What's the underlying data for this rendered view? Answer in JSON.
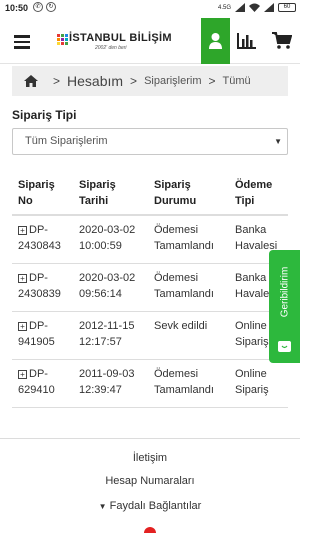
{
  "status_bar": {
    "time": "10:50",
    "battery": "60",
    "network": "4.5G"
  },
  "header": {
    "logo_text": "İSTANBUL BİLİŞİM",
    "logo_tagline": "2002' den beri",
    "icons": [
      "menu-icon",
      "user-icon",
      "bar-chart-icon",
      "cart-icon"
    ],
    "accent_color": "#2ea62a"
  },
  "breadcrumb": {
    "items": [
      "Hesabım",
      "Siparişlerim",
      "Tümü"
    ],
    "separator": ">"
  },
  "filter": {
    "label": "Sipariş Tipi",
    "selected": "Tüm Siparişlerim"
  },
  "table": {
    "headers": [
      [
        "Sipariş",
        "No"
      ],
      [
        "Sipariş",
        "Tarihi"
      ],
      [
        "Sipariş",
        "Durumu"
      ],
      [
        "Ödeme",
        "Tipi"
      ]
    ],
    "rows": [
      {
        "no_1": "DP-",
        "no_2": "2430843",
        "date": "2020-03-02",
        "time": "10:00:59",
        "status_1": "Ödemesi",
        "status_2": "Tamamlandı",
        "pay_1": "Banka",
        "pay_2": "Havalesi"
      },
      {
        "no_1": "DP-",
        "no_2": "2430839",
        "date": "2020-03-02",
        "time": "09:56:14",
        "status_1": "Ödemesi",
        "status_2": "Tamamlandı",
        "pay_1": "Banka",
        "pay_2": "Havalesi"
      },
      {
        "no_1": "DP-",
        "no_2": "941905",
        "date": "2012-11-15",
        "time": "12:17:57",
        "status_1": "Sevk edildi",
        "status_2": "",
        "pay_1": "Online",
        "pay_2": "Sipariş"
      },
      {
        "no_1": "DP-",
        "no_2": "629410",
        "date": "2011-09-03",
        "time": "12:39:47",
        "status_1": "Ödemesi",
        "status_2": "Tamamlandı",
        "pay_1": "Online",
        "pay_2": "Sipariş"
      }
    ]
  },
  "feedback": {
    "label": "Geribildirim",
    "color": "#2db83d"
  },
  "footer": {
    "links": [
      "İletişim",
      "Hesap Numaraları",
      "Faydalı Bağlantılar"
    ],
    "phone_color": "#e32121"
  }
}
